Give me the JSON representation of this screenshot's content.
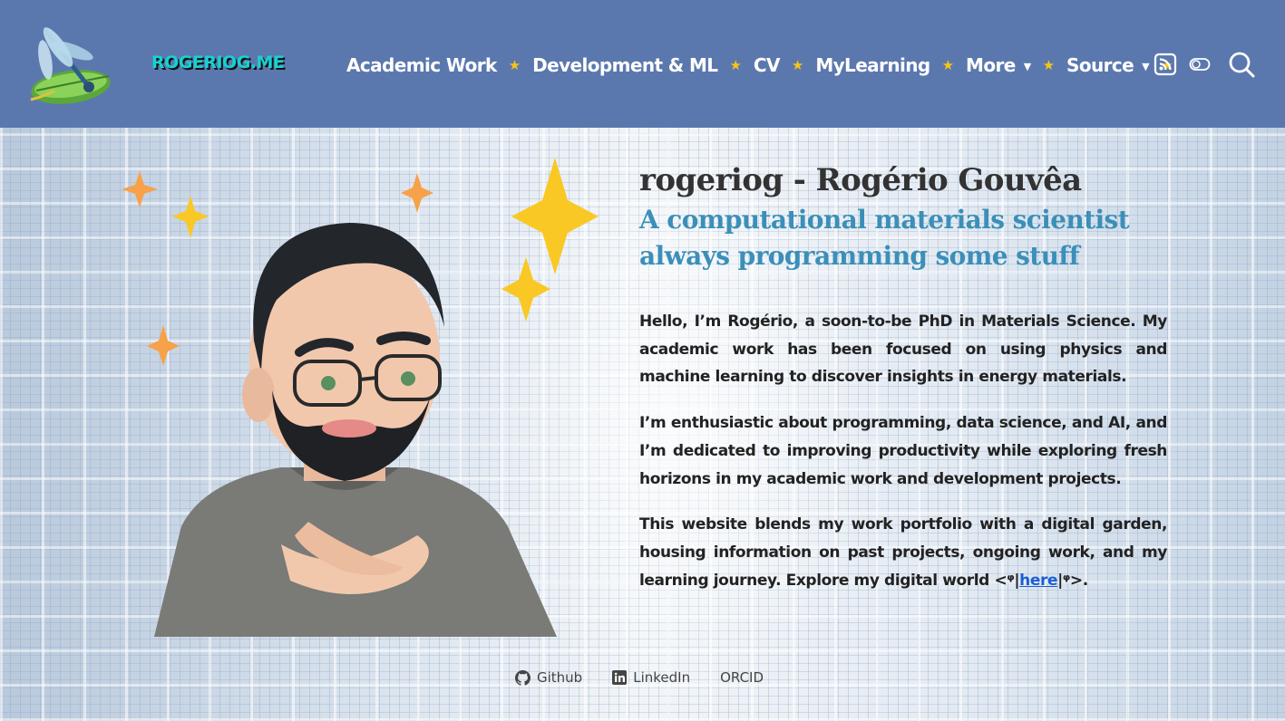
{
  "header": {
    "brand": "ROGERIOG.ME",
    "nav": [
      {
        "label": "Academic Work"
      },
      {
        "label": "Development & ML"
      },
      {
        "label": "CV"
      },
      {
        "label": "MyLearning"
      },
      {
        "label": "More",
        "icon": "chevron-down-icon"
      },
      {
        "label": "Source",
        "icon": "chevron-down-icon"
      }
    ],
    "separator_icon": "star-icon",
    "icons": [
      "rss-icon",
      "theme-toggle-icon",
      "search-icon"
    ]
  },
  "hero": {
    "title": "rogeriog - Rogério Gouvêa",
    "subtitle_line1": "A computational materials scientist",
    "subtitle_line2": "always programming some stuff",
    "paragraph1": "Hello, I’m Rogério, a soon-to-be PhD in Materials Science. My academic work has been focused on using physics and machine learning to discover insights in energy materials.",
    "paragraph2": "I’m enthusiastic about programming, data science, and AI, and I’m dedicated to improving productivity while exploring fresh horizons in my academic work and development projects.",
    "paragraph3_prefix": "This website blends my work portfolio with a digital garden, housing information on past projects, ongoing work, and my learning journey. Explore my digital world <",
    "link_left_glyph": "ᵠ",
    "link_text": "here",
    "link_right_glyph": "ᵠ",
    "paragraph3_suffix": ">.",
    "pipe": "|"
  },
  "social": [
    {
      "label": "Github",
      "icon": "github-icon"
    },
    {
      "label": "LinkedIn",
      "icon": "linkedin-icon"
    },
    {
      "label": "ORCID"
    }
  ],
  "colors": {
    "navbar": "#5b78ae",
    "brand": "#18d1d1",
    "star": "#f5c518",
    "subtitle": "#3b8fb8",
    "link": "#1a5fd6"
  }
}
